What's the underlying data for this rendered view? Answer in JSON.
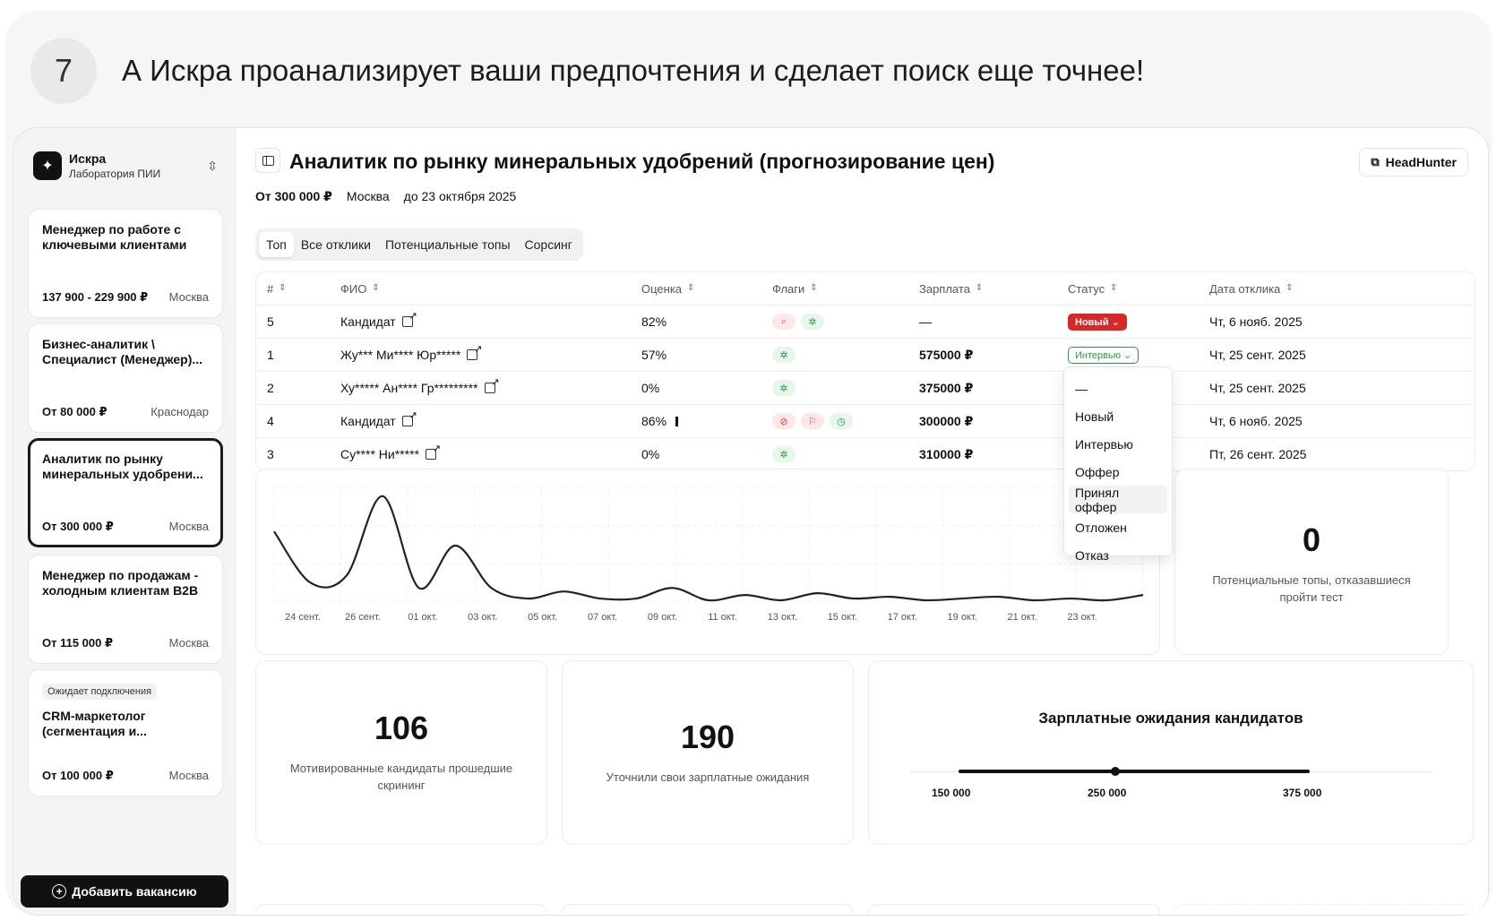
{
  "step": {
    "number": "7",
    "heading": "А Искра проанализирует ваши предпочтения и сделает поиск еще точнее!"
  },
  "org": {
    "name": "Искра",
    "subtitle": "Лаборатория ПИИ"
  },
  "vacancies": [
    {
      "title": "Менеджер по работе с ключевыми клиентами",
      "salary": "137 900 - 229 900 ₽",
      "city": "Москва",
      "badge": ""
    },
    {
      "title": "Бизнес-аналитик \\ Специалист (Менеджер)...",
      "salary": "От 80 000 ₽",
      "city": "Краснодар",
      "badge": ""
    },
    {
      "title": "Аналитик по рынку минеральных удобрени...",
      "salary": "От 300 000 ₽",
      "city": "Москва",
      "badge": ""
    },
    {
      "title": "Менеджер по продажам - холодным клиентам B2B",
      "salary": "От 115 000 ₽",
      "city": "Москва",
      "badge": ""
    },
    {
      "title": "CRM-маркетолог (сегментация и...",
      "salary": "От 100 000 ₽",
      "city": "Москва",
      "badge": "Ожидает подключения"
    }
  ],
  "add_vacancy_label": "Добавить вакансию",
  "vacancy": {
    "title": "Аналитик по рынку минеральных удобрений (прогнозирование цен)",
    "salary": "От 300 000 ₽",
    "city": "Москва",
    "deadline": "до 23 октября 2025"
  },
  "headhunter_label": "HeadHunter",
  "tabs": [
    "Топ",
    "Все отклики",
    "Потенциальные топы",
    "Сорсинг"
  ],
  "table": {
    "headers": [
      "#",
      "ФИО",
      "Оценка",
      "Флаги",
      "Зарплата",
      "Статус",
      "Дата отклика"
    ],
    "rows": [
      {
        "num": "5",
        "name": "Кандидат",
        "score": "82%",
        "flags": [
          "red-search",
          "green-spark"
        ],
        "salary": "—",
        "status": "Новый",
        "date": "Чт, 6 нояб. 2025"
      },
      {
        "num": "1",
        "name": "Жу*** Ми**** Юр*****",
        "score": "57%",
        "flags": [
          "green-spark"
        ],
        "salary": "575000 ₽",
        "status": "Интервью",
        "date": "Чт, 25 сент. 2025"
      },
      {
        "num": "2",
        "name": "Ху***** Ан**** Гр*********",
        "score": "0%",
        "flags": [
          "green-spark"
        ],
        "salary": "375000 ₽",
        "status": "",
        "date": "Чт, 25 сент. 2025"
      },
      {
        "num": "4",
        "name": "Кандидат",
        "score": "86%",
        "flags": [
          "red-ban",
          "red-flag",
          "green-clock"
        ],
        "salary": "300000 ₽",
        "status": "",
        "date": "Чт, 6 нояб. 2025"
      },
      {
        "num": "3",
        "name": "Су**** Ни*****",
        "score": "0%",
        "flags": [
          "green-spark"
        ],
        "salary": "310000 ₽",
        "status": "",
        "date": "Пт, 26 сент. 2025"
      }
    ]
  },
  "status_options": [
    "—",
    "Новый",
    "Интервью",
    "Оффер",
    "Принял оффер",
    "Отложен",
    "Отказ"
  ],
  "chart_data": {
    "type": "line",
    "x": [
      "24 сент.",
      "26 сент.",
      "01 окт.",
      "03 окт.",
      "05 окт.",
      "07 окт.",
      "09 окт.",
      "11 окт.",
      "13 окт.",
      "15 окт.",
      "17 окт.",
      "19 окт.",
      "21 окт.",
      "23 окт."
    ],
    "values": [
      4,
      1.1,
      1.5,
      6,
      0.8,
      3.2,
      0.8,
      0.2,
      0.6,
      0.2,
      0.2,
      0.8,
      0.1,
      0.4,
      0.1,
      0.5,
      0.2,
      0.3,
      0.1,
      0.2,
      0.3,
      0.1,
      0.2,
      0.1,
      0.4
    ],
    "ylim": [
      0,
      6.5
    ],
    "grid": true
  },
  "stats": {
    "declined_test": {
      "value": "0",
      "label": "Потенциальные топы, отказавшиеся пройти тест"
    },
    "motivated": {
      "value": "106",
      "label": "Мотивированные кандидаты прошедшие скрининг"
    },
    "clarified": {
      "value": "190",
      "label": "Уточнили свои зарплатные ожидания"
    }
  },
  "salary_range": {
    "title": "Зарплатные ожидания кандидатов",
    "min_label": "150 000",
    "mid_label": "250 000",
    "max_label": "375 000"
  },
  "colors": {
    "accent_red": "#d62828",
    "accent_green": "#2a9a48",
    "dark": "#111111"
  }
}
